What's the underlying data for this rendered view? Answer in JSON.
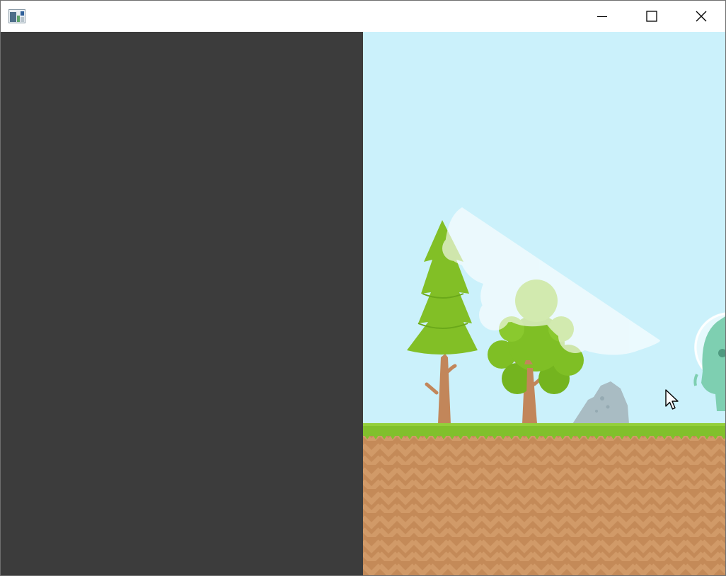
{
  "window": {
    "title": "",
    "controls": {
      "minimize_icon": "minimize-icon",
      "maximize_icon": "maximize-icon",
      "close_icon": "close-icon"
    }
  },
  "left_pane": {
    "color": "#3c3c3c"
  },
  "game": {
    "sky_color": "#cbf1fb",
    "grass_color": "#81c02c",
    "dirt_color": "#c88d5b",
    "scene_objects": [
      "pine-tree",
      "round-tree",
      "cloud",
      "rock",
      "alien-player"
    ]
  },
  "cursor": {
    "icon": "arrow-cursor-icon"
  }
}
